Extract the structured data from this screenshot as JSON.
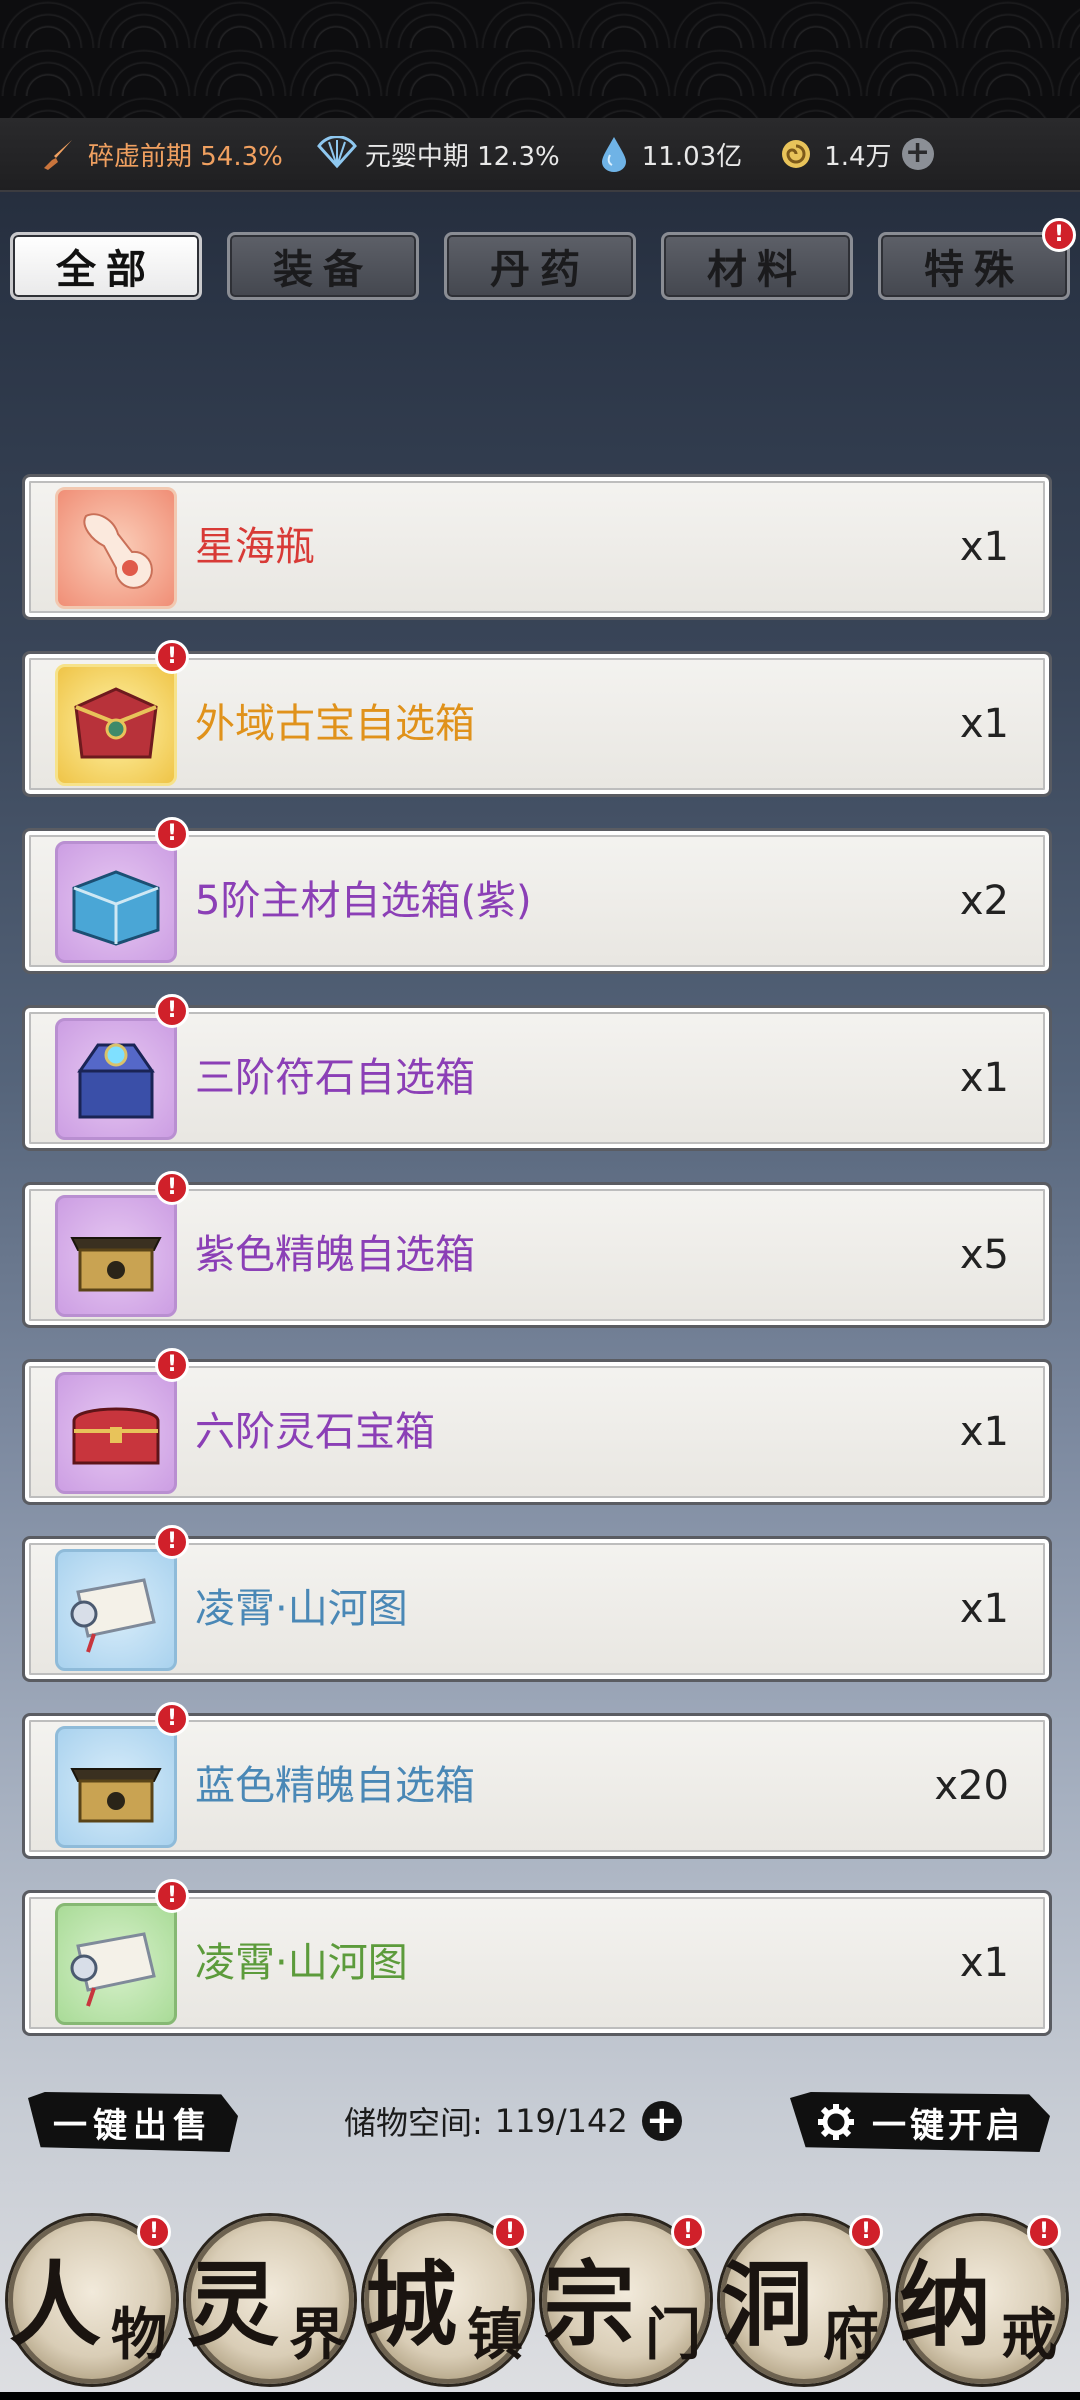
{
  "status_bar": {
    "realm": {
      "label": "碎虚前期 54.3%",
      "icon": "sword-icon",
      "color": "#f0a060"
    },
    "cultivation": {
      "label": "元婴中期 12.3%",
      "icon": "fan-icon"
    },
    "spirit_stone": {
      "label": "11.03亿",
      "icon": "water-drop-icon"
    },
    "currency": {
      "label": "1.4万",
      "icon": "swirl-coin-icon"
    },
    "add_icon": "plus-icon"
  },
  "tabs": [
    {
      "label": "全部",
      "active": true
    },
    {
      "label": "装备",
      "active": false
    },
    {
      "label": "丹药",
      "active": false
    },
    {
      "label": "材料",
      "active": false
    },
    {
      "label": "特殊",
      "active": false,
      "badge": "!"
    }
  ],
  "items": [
    {
      "name": "星海瓶",
      "qty": "x1",
      "rarity": "red",
      "icon": "star-sea-bottle-icon",
      "badge": ""
    },
    {
      "name": "外域古宝自选箱",
      "qty": "x1",
      "rarity": "gold",
      "icon": "treasure-chest-icon",
      "badge": "!"
    },
    {
      "name": "5阶主材自选箱(紫)",
      "qty": "x2",
      "rarity": "purple",
      "icon": "blue-chest-icon",
      "badge": "!"
    },
    {
      "name": "三阶符石自选箱",
      "qty": "x1",
      "rarity": "purple",
      "icon": "ornate-chest-icon",
      "badge": "!"
    },
    {
      "name": "紫色精魄自选箱",
      "qty": "x5",
      "rarity": "purple",
      "icon": "gold-box-icon",
      "badge": "!"
    },
    {
      "name": "六阶灵石宝箱",
      "qty": "x1",
      "rarity": "purple",
      "icon": "red-chest-icon",
      "badge": "!"
    },
    {
      "name": "凌霄·山河图",
      "qty": "x1",
      "rarity": "blue",
      "icon": "scroll-icon",
      "badge": "!"
    },
    {
      "name": "蓝色精魄自选箱",
      "qty": "x20",
      "rarity": "blue",
      "icon": "gold-box-icon",
      "badge": "!"
    },
    {
      "name": "凌霄·山河图",
      "qty": "x1",
      "rarity": "green",
      "icon": "scroll-icon",
      "badge": "!"
    }
  ],
  "bottom_bar": {
    "sell_all": "一键出售",
    "storage_label": "储物空间:",
    "storage_value": "119/142",
    "open_all": "一键开启",
    "gear_icon": "gear-icon"
  },
  "nav": [
    {
      "big": "人",
      "small": "物",
      "badge": "!"
    },
    {
      "big": "灵",
      "small": "界",
      "badge": ""
    },
    {
      "big": "城",
      "small": "镇",
      "badge": "!"
    },
    {
      "big": "宗",
      "small": "门",
      "badge": "!"
    },
    {
      "big": "洞",
      "small": "府",
      "badge": "!"
    },
    {
      "big": "纳",
      "small": "戒",
      "badge": "!"
    }
  ],
  "colors": {
    "red": "#d83a36",
    "gold": "#e0921b",
    "purple": "#8b3fb6",
    "blue": "#4a88b6",
    "green": "#5c9b3b",
    "badge": "#d0202a"
  }
}
